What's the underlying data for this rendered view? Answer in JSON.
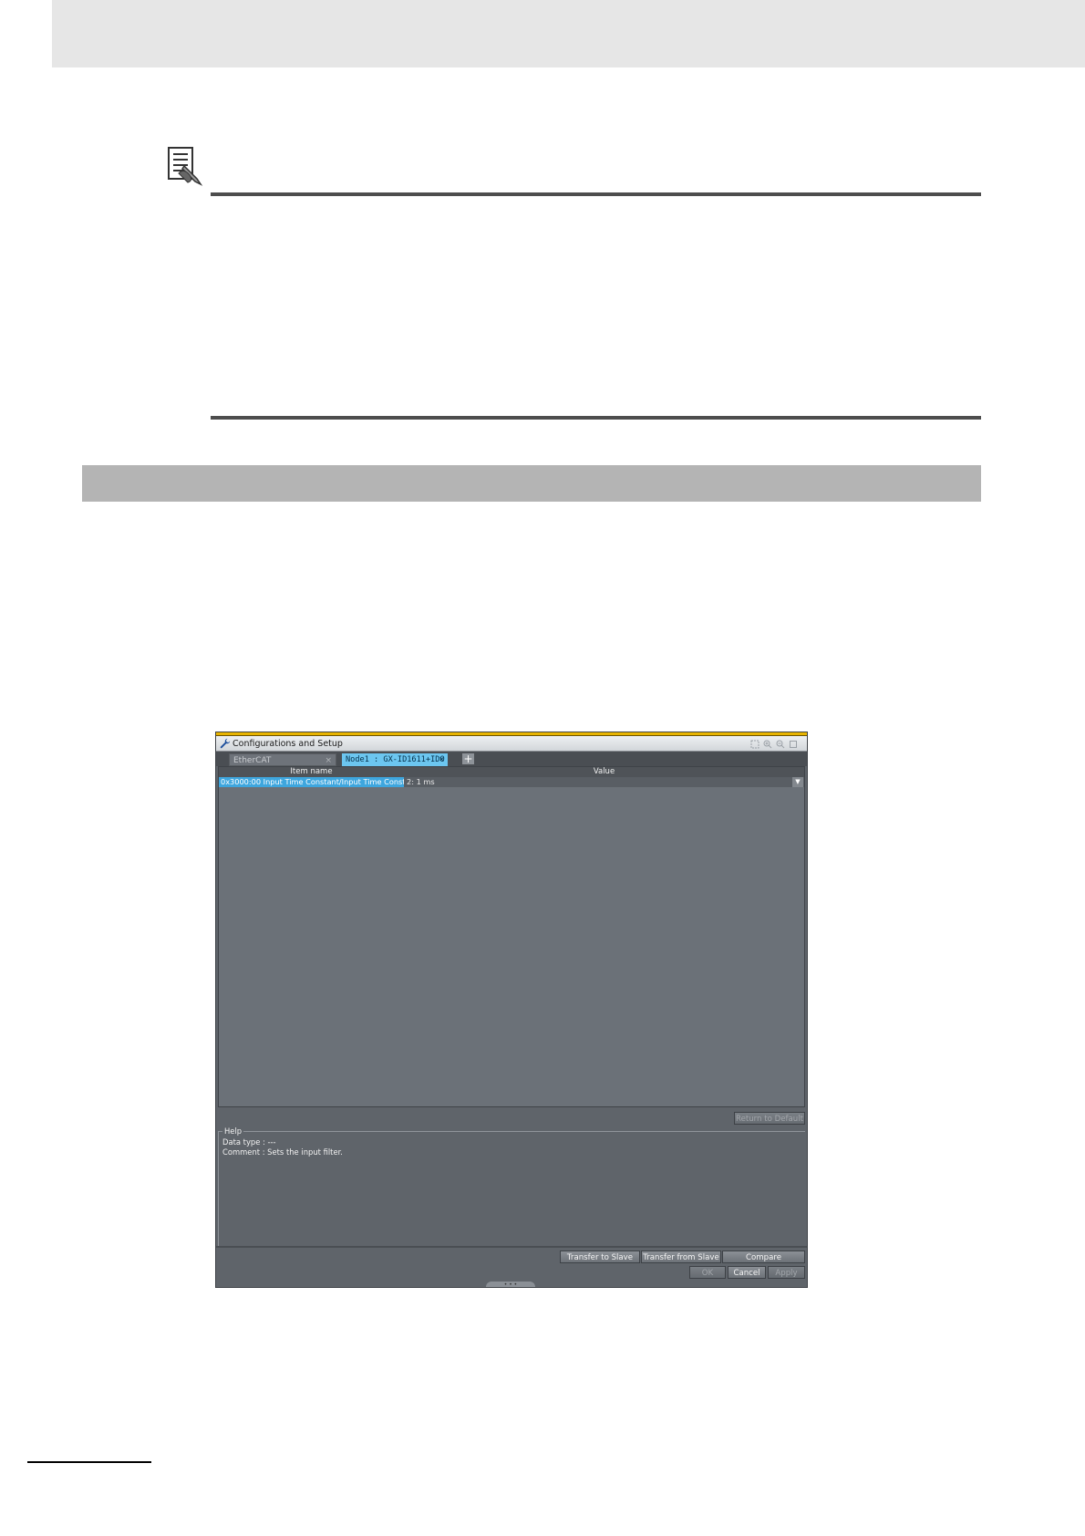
{
  "screenshot": {
    "window_title": "Configurations and Setup",
    "tabs": [
      {
        "label": "EtherCAT",
        "close": "×",
        "active": false
      },
      {
        "label": "Node1 : GX-ID1611+IDO",
        "close": "×",
        "active": true
      }
    ],
    "add_tab_symbol": "+",
    "grid": {
      "columns": [
        "Item name",
        "Value"
      ],
      "rows": [
        {
          "item": "0x3000:00 Input Time Constant/Input Time Constant",
          "value": "2: 1 ms"
        }
      ]
    },
    "return_to_default_label": "Return to Default",
    "help": {
      "legend": "Help",
      "data_type": "Data type : ---",
      "comment": "Comment : Sets the input filter."
    },
    "buttons": {
      "transfer_to_slave": "Transfer to Slave",
      "transfer_from_slave": "Transfer from Slave",
      "compare": "Compare",
      "ok": "OK",
      "cancel": "Cancel",
      "apply": "Apply"
    },
    "colors": {
      "accent": "#e8b400",
      "selected_tab": "#6cc6f0",
      "selected_cell": "#3ea6de",
      "panel": "#6b7178"
    }
  }
}
